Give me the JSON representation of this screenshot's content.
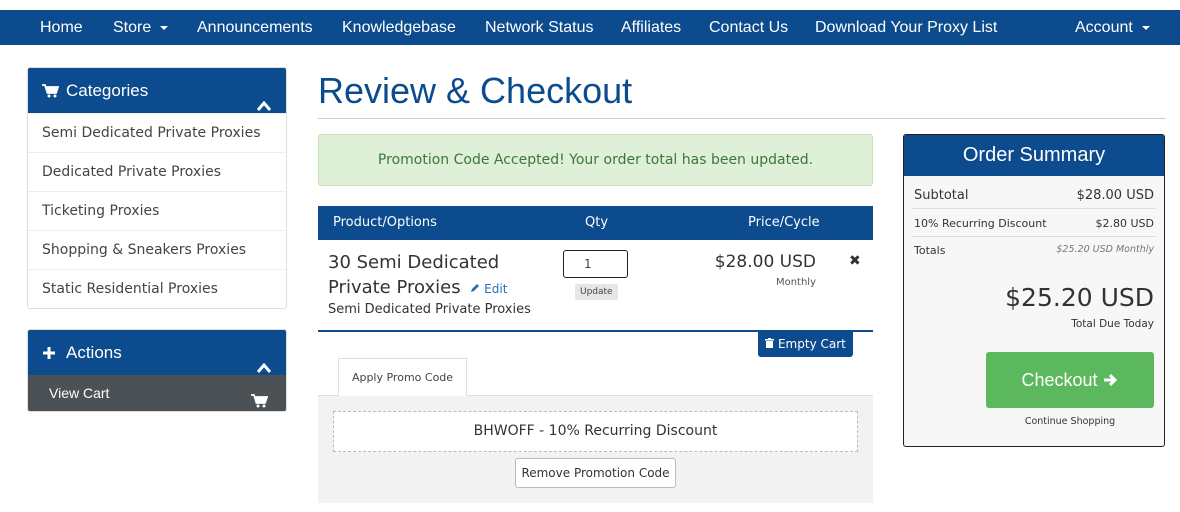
{
  "nav": {
    "items": [
      {
        "label": "Home"
      },
      {
        "label": "Store"
      },
      {
        "label": "Announcements"
      },
      {
        "label": "Knowledgebase"
      },
      {
        "label": "Network Status"
      },
      {
        "label": "Affiliates"
      },
      {
        "label": "Contact Us"
      },
      {
        "label": "Download Your Proxy List"
      }
    ],
    "account_label": "Account"
  },
  "sidebar": {
    "categories_title": "Categories",
    "categories": [
      {
        "label": "Semi Dedicated Private Proxies"
      },
      {
        "label": "Dedicated Private Proxies"
      },
      {
        "label": "Ticketing Proxies"
      },
      {
        "label": "Shopping & Sneakers Proxies"
      },
      {
        "label": "Static Residential Proxies"
      }
    ],
    "actions_title": "Actions",
    "view_cart_label": "View Cart"
  },
  "page": {
    "title": "Review & Checkout",
    "alert": "Promotion Code Accepted! Your order total has been updated."
  },
  "cart": {
    "headers": {
      "product": "Product/Options",
      "qty": "Qty",
      "price": "Price/Cycle"
    },
    "item": {
      "name": "30 Semi Dedicated Private Proxies",
      "edit_label": "Edit",
      "group": "Semi Dedicated Private Proxies",
      "qty": "1",
      "update_label": "Update",
      "price": "$28.00 USD",
      "cycle": "Monthly"
    },
    "empty_cart_label": "Empty Cart"
  },
  "promo": {
    "tab_label": "Apply Promo Code",
    "applied_code": "BHWOFF - 10% Recurring Discount",
    "remove_label": "Remove Promotion Code"
  },
  "summary": {
    "title": "Order Summary",
    "subtotal_label": "Subtotal",
    "subtotal_value": "$28.00 USD",
    "discount_label": "10% Recurring Discount",
    "discount_value": "$2.80 USD",
    "totals_label": "Totals",
    "totals_value": "$25.20 USD Monthly",
    "total_due": "$25.20 USD",
    "total_due_label": "Total Due Today",
    "checkout_label": "Checkout",
    "continue_label": "Continue Shopping"
  },
  "colors": {
    "brand": "#0c4b8e",
    "success": "#5cb85c",
    "alert_bg": "#dff0d8",
    "sidebar_dark": "#4b5155"
  },
  "icons": [
    "chevron-down-icon",
    "cart-icon",
    "chevron-up-icon",
    "plus-icon",
    "pencil-icon",
    "close-icon",
    "trash-icon",
    "arrow-right-icon"
  ]
}
